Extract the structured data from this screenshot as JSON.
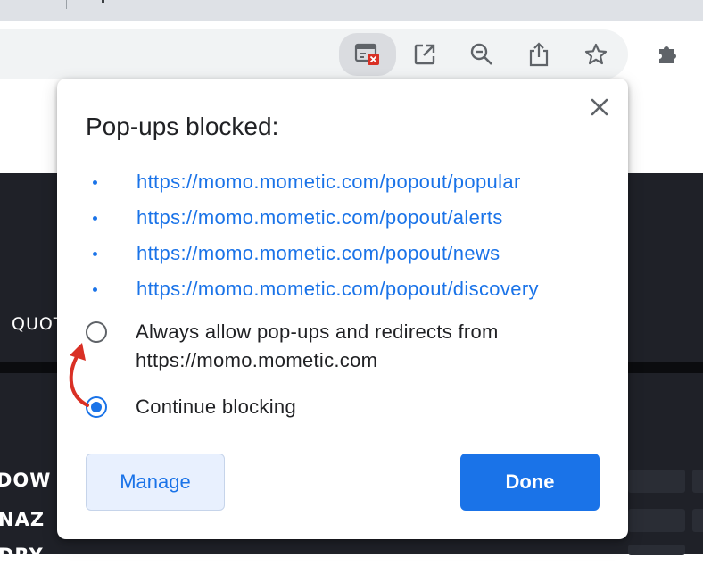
{
  "browser": {
    "toolbar_icons": [
      {
        "name": "popup-blocked-icon",
        "active": true
      },
      {
        "name": "open-in-new-icon"
      },
      {
        "name": "zoom-out-icon"
      },
      {
        "name": "share-icon"
      },
      {
        "name": "star-icon"
      },
      {
        "name": "extensions-puzzle-icon"
      }
    ]
  },
  "webpage": {
    "labels": [
      "QUOT",
      "DOW",
      "NAZ",
      "DRY"
    ]
  },
  "dialog": {
    "title": "Pop-ups blocked:",
    "close_label": "×",
    "urls": [
      "https://momo.mometic.com/popout/popular",
      "https://momo.mometic.com/popout/alerts",
      "https://momo.mometic.com/popout/news",
      "https://momo.mometic.com/popout/discovery"
    ],
    "options": [
      {
        "label_line1": "Always allow pop-ups and redirects from",
        "label_line2": "https://momo.mometic.com",
        "selected": false
      },
      {
        "label_line1": "Continue blocking",
        "selected": true
      }
    ],
    "manage_label": "Manage",
    "done_label": "Done"
  },
  "colors": {
    "accent": "#1a73e8",
    "annotation_arrow": "#d93025",
    "page_dark": "#1f2128",
    "blocked_badge": "#d93025"
  }
}
